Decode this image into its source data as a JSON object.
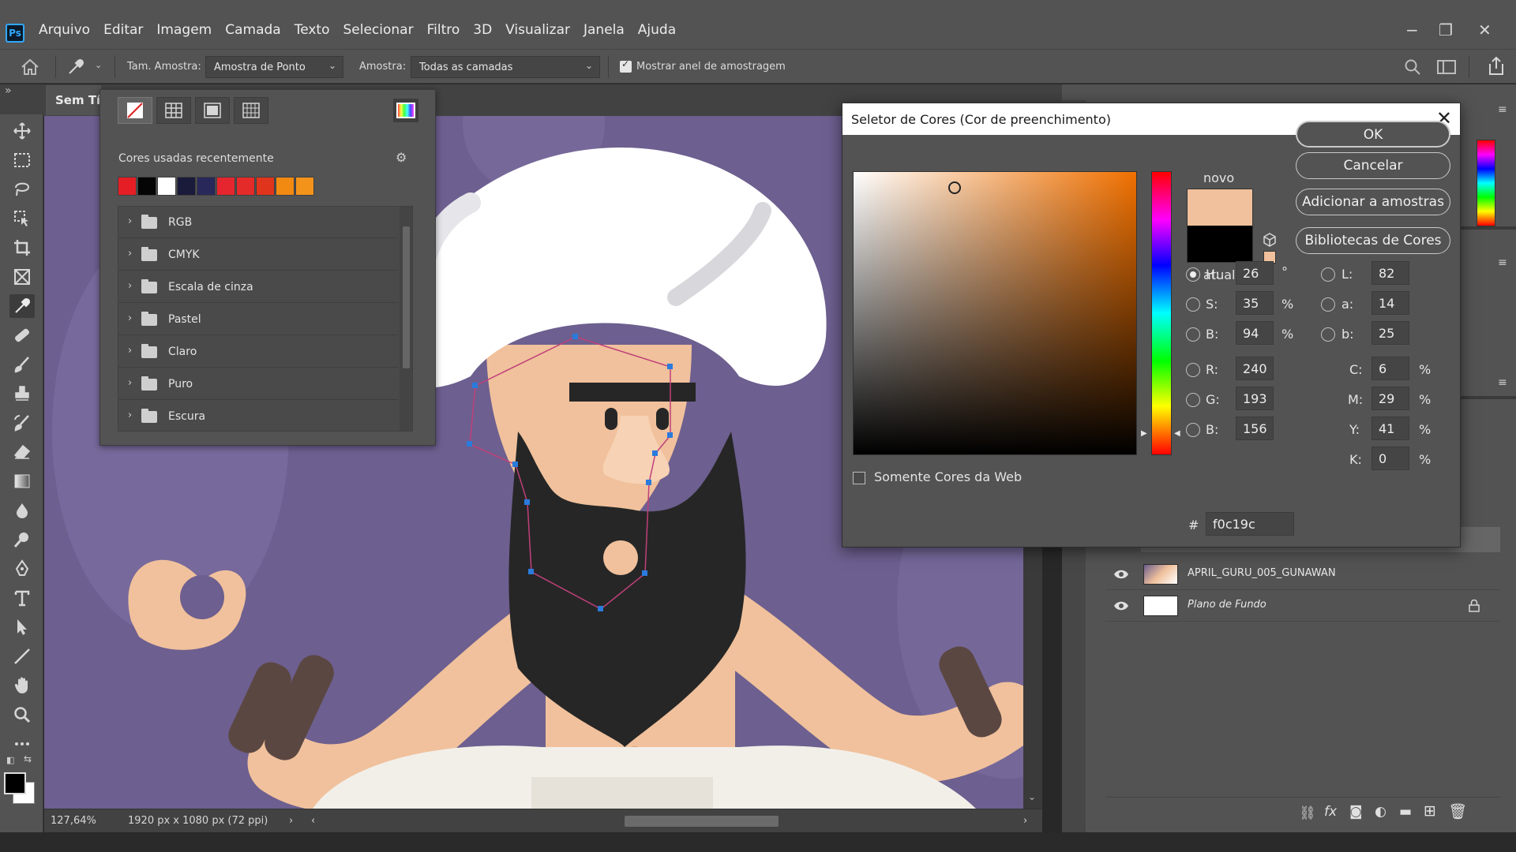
{
  "app": {
    "logo": "Ps"
  },
  "menu": {
    "items": [
      "Arquivo",
      "Editar",
      "Imagem",
      "Camada",
      "Texto",
      "Selecionar",
      "Filtro",
      "3D",
      "Visualizar",
      "Janela",
      "Ajuda"
    ]
  },
  "options": {
    "sample_size_label": "Tam. Amostra:",
    "sample_size_value": "Amostra de Ponto",
    "sample_label": "Amostra:",
    "sample_value": "Todas as camadas",
    "show_ring_label": "Mostrar anel de amostragem",
    "show_ring_checked": true
  },
  "document": {
    "tab_title": "Sem Título"
  },
  "status": {
    "zoom": "127,64%",
    "doc_size": "1920 px x 1080 px (72 ppi)"
  },
  "swatches_panel": {
    "recent_label": "Cores usadas recentemente",
    "recent_colors": [
      "#e51e25",
      "#050505",
      "#ffffff",
      "#1a1a3a",
      "#28285a",
      "#e5262e",
      "#e52a2a",
      "#e0341c",
      "#f28a12",
      "#f3931a"
    ],
    "groups": [
      "RGB",
      "CMYK",
      "Escala de cinza",
      "Pastel",
      "Claro",
      "Puro",
      "Escura"
    ]
  },
  "color_picker": {
    "title": "Seletor de Cores (Cor de preenchimento)",
    "new_label": "novo",
    "current_label": "atual",
    "new_color": "#f0c19c",
    "current_color": "#000000",
    "buttons": {
      "ok": "OK",
      "cancel": "Cancelar",
      "add_to_swatches": "Adicionar a amostras",
      "color_libraries": "Bibliotecas de Cores"
    },
    "web_only_label": "Somente Cores da Web",
    "fields": {
      "H": "26",
      "S": "35",
      "Bv": "94",
      "R": "240",
      "G": "193",
      "Bc": "156",
      "L": "82",
      "a": "14",
      "b": "25",
      "C": "6",
      "M": "29",
      "Y": "41",
      "K": "0",
      "hex": "f0c19c"
    },
    "labels": {
      "H": "H:",
      "S": "S:",
      "Bv": "B:",
      "R": "R:",
      "G": "G:",
      "Bc": "B:",
      "L": "L:",
      "a": "a:",
      "b": "b:",
      "C": "C:",
      "M": "M:",
      "Y": "Y:",
      "K": "K:",
      "hash": "#",
      "deg": "°",
      "pct": "%"
    }
  },
  "layers": {
    "items": [
      {
        "name": "APRIL_GURU_005_GUNAWAN",
        "visible": true
      },
      {
        "name": "Plano de Fundo",
        "visible": true,
        "locked": true
      }
    ]
  },
  "colors": {
    "accent": "#31a8ff",
    "panel": "#535353",
    "canvas_bg": "#6d5f8f"
  }
}
